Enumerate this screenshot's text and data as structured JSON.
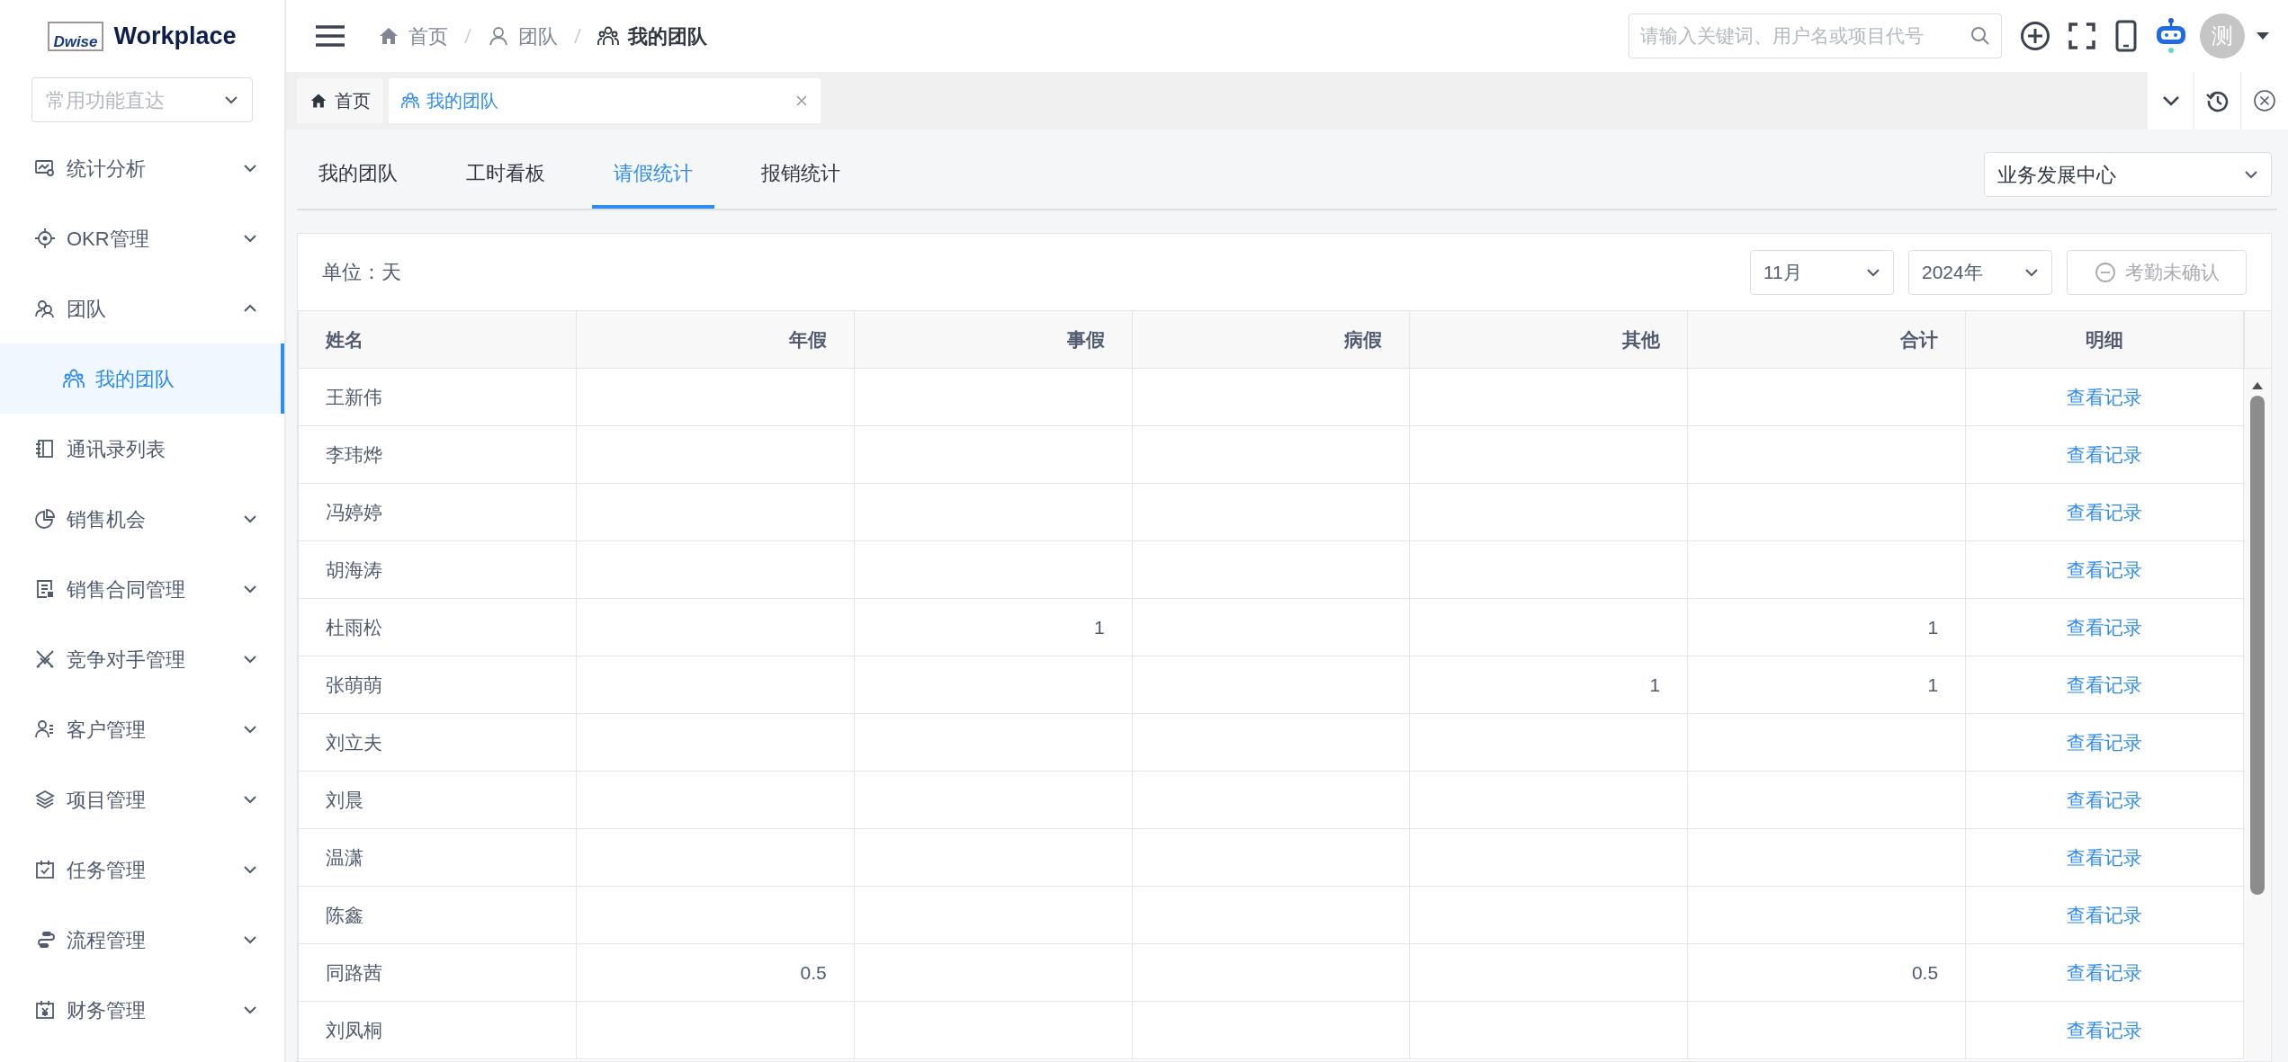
{
  "logo": {
    "mark": "Dwise",
    "title": "Workplace"
  },
  "quick_nav": {
    "placeholder": "常用功能直达"
  },
  "sidebar": {
    "items": [
      {
        "label": "统计分析",
        "expanded": false,
        "selected": false
      },
      {
        "label": "OKR管理",
        "expanded": false,
        "selected": false
      },
      {
        "label": "团队",
        "expanded": true,
        "selected": false,
        "children": [
          {
            "label": "我的团队",
            "selected": true
          }
        ]
      },
      {
        "label": "通讯录列表",
        "selected": false
      },
      {
        "label": "销售机会",
        "expanded": false,
        "selected": false
      },
      {
        "label": "销售合同管理",
        "expanded": false,
        "selected": false
      },
      {
        "label": "竞争对手管理",
        "expanded": false,
        "selected": false
      },
      {
        "label": "客户管理",
        "expanded": false,
        "selected": false
      },
      {
        "label": "项目管理",
        "expanded": false,
        "selected": false
      },
      {
        "label": "任务管理",
        "expanded": false,
        "selected": false
      },
      {
        "label": "流程管理",
        "expanded": false,
        "selected": false
      },
      {
        "label": "财务管理",
        "expanded": false,
        "selected": false
      }
    ]
  },
  "breadcrumbs": [
    {
      "label": "首页",
      "current": false
    },
    {
      "label": "团队",
      "current": false
    },
    {
      "label": "我的团队",
      "current": true
    }
  ],
  "search": {
    "placeholder": "请输入关键词、用户名或项目代号"
  },
  "avatar": {
    "text": "测"
  },
  "page_tabs": [
    {
      "label": "首页",
      "selected": false,
      "closable": false
    },
    {
      "label": "我的团队",
      "selected": true,
      "closable": true
    }
  ],
  "tabs": [
    {
      "label": "我的团队",
      "selected": false
    },
    {
      "label": "工时看板",
      "selected": false
    },
    {
      "label": "请假统计",
      "selected": true
    },
    {
      "label": "报销统计",
      "selected": false
    }
  ],
  "department_select": {
    "value": "业务发展中心"
  },
  "unit_label": "单位：天",
  "month_select": {
    "value": "11月"
  },
  "year_select": {
    "value": "2024年"
  },
  "confirm_button": {
    "label": "考勤未确认",
    "disabled": true
  },
  "table": {
    "columns": [
      "姓名",
      "年假",
      "事假",
      "病假",
      "其他",
      "合计",
      "明细"
    ],
    "rows": [
      [
        "王新伟",
        "",
        "",
        "",
        "",
        "",
        "查看记录"
      ],
      [
        "李玮烨",
        "",
        "",
        "",
        "",
        "",
        "查看记录"
      ],
      [
        "冯婷婷",
        "",
        "",
        "",
        "",
        "",
        "查看记录"
      ],
      [
        "胡海涛",
        "",
        "",
        "",
        "",
        "",
        "查看记录"
      ],
      [
        "杜雨松",
        "",
        "1",
        "",
        "",
        "1",
        "查看记录"
      ],
      [
        "张萌萌",
        "",
        "",
        "",
        "1",
        "1",
        "查看记录"
      ],
      [
        "刘立夫",
        "",
        "",
        "",
        "",
        "",
        "查看记录"
      ],
      [
        "刘晨",
        "",
        "",
        "",
        "",
        "",
        "查看记录"
      ],
      [
        "温潇",
        "",
        "",
        "",
        "",
        "",
        "查看记录"
      ],
      [
        "陈鑫",
        "",
        "",
        "",
        "",
        "",
        "查看记录"
      ],
      [
        "同路茜",
        "0.5",
        "",
        "",
        "",
        "0.5",
        "查看记录"
      ],
      [
        "刘凤桐",
        "",
        "",
        "",
        "",
        "",
        "查看记录"
      ]
    ]
  }
}
